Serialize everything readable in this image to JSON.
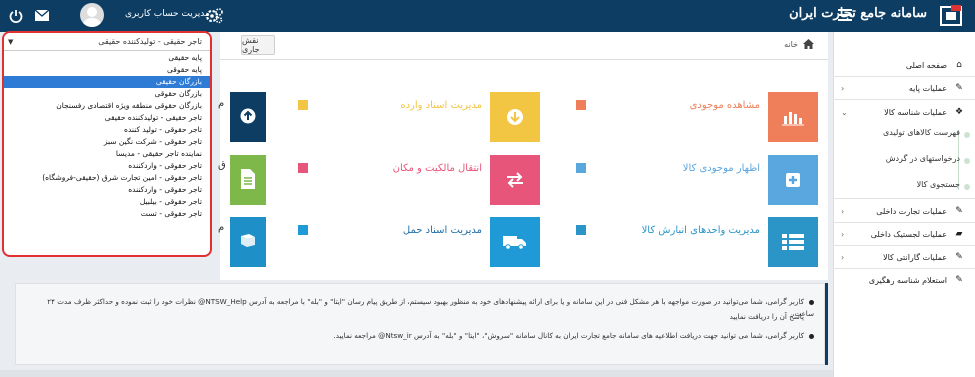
{
  "header": {
    "brand": "سامانه جامع تجارت ایران",
    "account_label": "مدیریت حساب کاربری"
  },
  "breadcrumb": {
    "home": "خانه"
  },
  "role": {
    "button_label": "نقش جاری",
    "selected": "تاجر حقیقی - تولیدکننده حقیقی",
    "options": [
      "پایه حقیقی",
      "پایه حقوقی",
      "بازرگان حقیقی",
      "بازرگان حقوقی",
      "بازرگان حقوقی منطقه ویژه اقتصادی رفسنجان",
      "تاجر حقیقی - تولیدکننده حقیقی",
      "تاجر حقوقی - تولید کننده",
      "تاجر حقوقی - شرکت نگین سبز",
      "نماینده تاجر حقیقی - مدیسا",
      "تاجر حقوقی - واردکننده",
      "تاجر حقوقی - امین تجارت شرق (حقیقی-فروشگاه)",
      "تاجر حقوقی - واردکننده",
      "تاجر حقوقی - بیلبیل",
      "تاجر حقوقی - تست"
    ],
    "selected_index": 2
  },
  "sidebar": {
    "items": [
      {
        "label": "صفحه اصلی",
        "icon": "home-icon"
      },
      {
        "label": "عملیات پایه",
        "icon": "edit-icon"
      },
      {
        "label": "عملیات شناسه کالا",
        "icon": "cubes-icon"
      },
      {
        "label": "عملیات تجارت داخلی",
        "icon": "edit-icon"
      },
      {
        "label": "عملیات لجستیک داخلی",
        "icon": "truck-icon"
      },
      {
        "label": "عملیات گارانتی کالا",
        "icon": "edit-icon"
      },
      {
        "label": "استعلام شناسه رهگیری",
        "icon": "edit-icon"
      }
    ],
    "sub_items": [
      "فهرست کالاهای تولیدی",
      "درخواستهای در گردش",
      "جستجوی کالا"
    ]
  },
  "tiles": [
    {
      "title": "مشاهده موجودی",
      "icon": "chart-icon",
      "color": "#ef7f5a"
    },
    {
      "title": "مدیریت اسناد وارده",
      "icon": "download-icon",
      "color": "#f2c543"
    },
    {
      "title": "اظهار موجودی کالا",
      "icon": "plus-icon",
      "color": "#5aa6df"
    },
    {
      "title": "انتقال مالکیت و مکان",
      "icon": "exchange-icon",
      "color": "#e8557a"
    },
    {
      "title": "مدیریت واحدهای انبارش کالا",
      "icon": "list-icon",
      "color": "#2b95c8"
    },
    {
      "title": "مدیریت اسناد حمل",
      "icon": "truck-icon",
      "color": "#1f9ad6"
    }
  ],
  "left_tiles": [
    {
      "label": "م",
      "icon": "upload-icon",
      "color": "#0d3d63"
    },
    {
      "label": "ق",
      "icon": "document-icon",
      "color": "#7fb84a"
    },
    {
      "label": "م",
      "icon": "book-icon",
      "color": "#1f8fc7"
    }
  ],
  "notices": [
    "کاربر گرامی، شما می‌توانید در صورت مواجهه با هر مشکل فنی در این سامانه و یا برای ارائه پیشنهادهای خود به منظور بهبود سیستم، از طریق پیام رسان \"ایتا\" و \"بله\" با مراجعه به آدرس NTSW_Help@ نظرات خود را ثبت نموده و حداکثر ظرف مدت ۲۴ ساعت،",
    "پاسخ آن را دریافت نمایید",
    "کاربر گرامی، شما می توانید جهت دریافت اطلاعیه های سامانه جامع تجارت ایران به کانال سامانه \"سروش\"، \"ایتا\" و \"بله\" به آدرس Ntsw_ir@ مراجعه نمایید."
  ]
}
